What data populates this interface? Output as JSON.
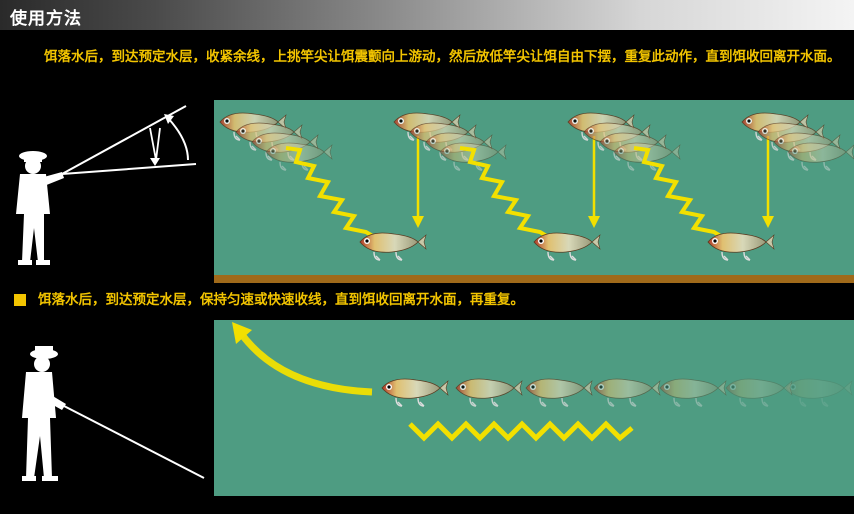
{
  "header": {
    "title": "使用方法"
  },
  "section1": {
    "instruction": "饵落水后，到达预定水层，收紧余线，上挑竿尖让饵震颤向上游动，然后放低竿尖让饵自由下摆，重复此动作，直到饵收回离开水面。"
  },
  "section2": {
    "instruction": "饵落水后，到达预定水层，保持匀速或快速收线，直到饵收回离开水面，再重复。"
  },
  "colors": {
    "water": "#4e9c82",
    "accent_yellow": "#f2c400",
    "floor": "#a06a1a",
    "background": "#000000"
  },
  "icons": {
    "angler1": "angler-casting-icon",
    "angler2": "angler-reeling-icon",
    "lure": "vib-lure-icon"
  }
}
